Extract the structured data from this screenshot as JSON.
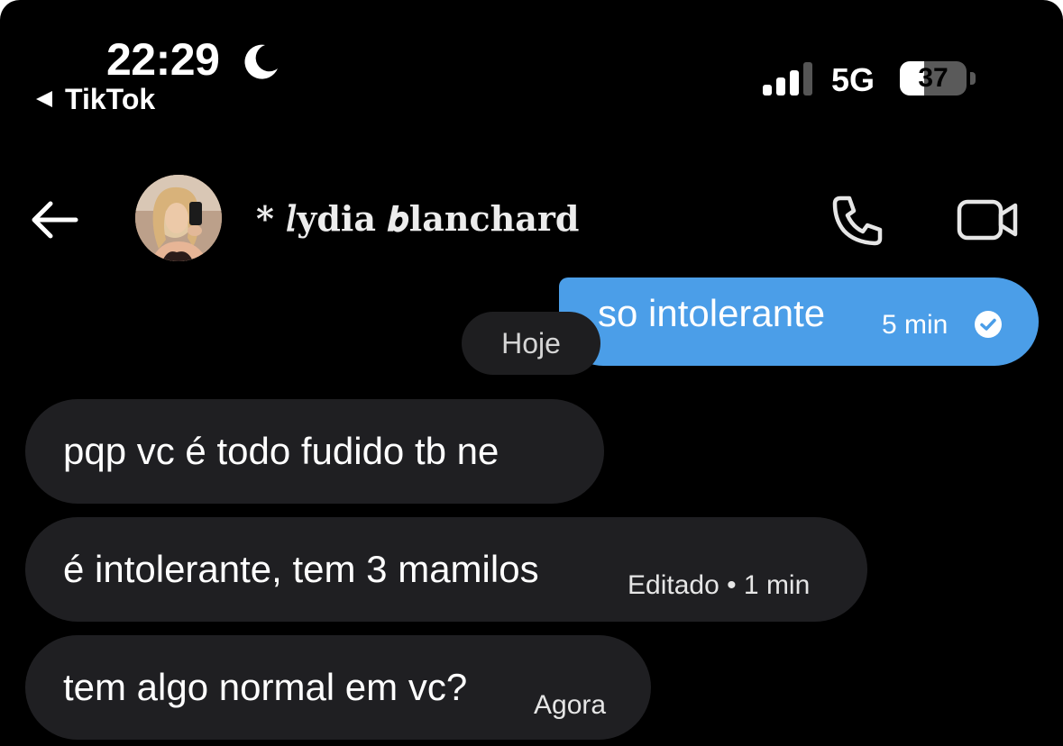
{
  "status_bar": {
    "time": "22:29",
    "moon_icon": "moon-icon",
    "back_app": "TikTok",
    "back_icon": "back-triangle-icon",
    "signal_icon": "cellular-signal-icon",
    "signal_bars_active": 3,
    "signal_bars_total": 4,
    "network": "5G",
    "battery_level": "37",
    "battery_fraction": 0.37
  },
  "header": {
    "back_icon": "arrow-left-icon",
    "contact_name": "* 𝑙ydia 𝒃lanchard",
    "avatar": "avatar",
    "call_icon": "phone-icon",
    "video_icon": "video-camera-icon"
  },
  "messages": {
    "sent": {
      "text": "so intolerante",
      "time": "5 min",
      "status_icon": "check-circle-icon"
    },
    "date_separator": "Hoje",
    "received": [
      {
        "text": "pqp vc é todo fudido tb ne",
        "meta": ""
      },
      {
        "text": "é intolerante, tem 3 mamilos",
        "meta": "Editado • 1 min"
      },
      {
        "text": "tem algo normal em vc?",
        "meta": "Agora"
      }
    ]
  },
  "colors": {
    "background": "#000000",
    "sent_bubble": "#4b9ee8",
    "received_bubble": "#1f1f22",
    "text": "#ffffff"
  }
}
